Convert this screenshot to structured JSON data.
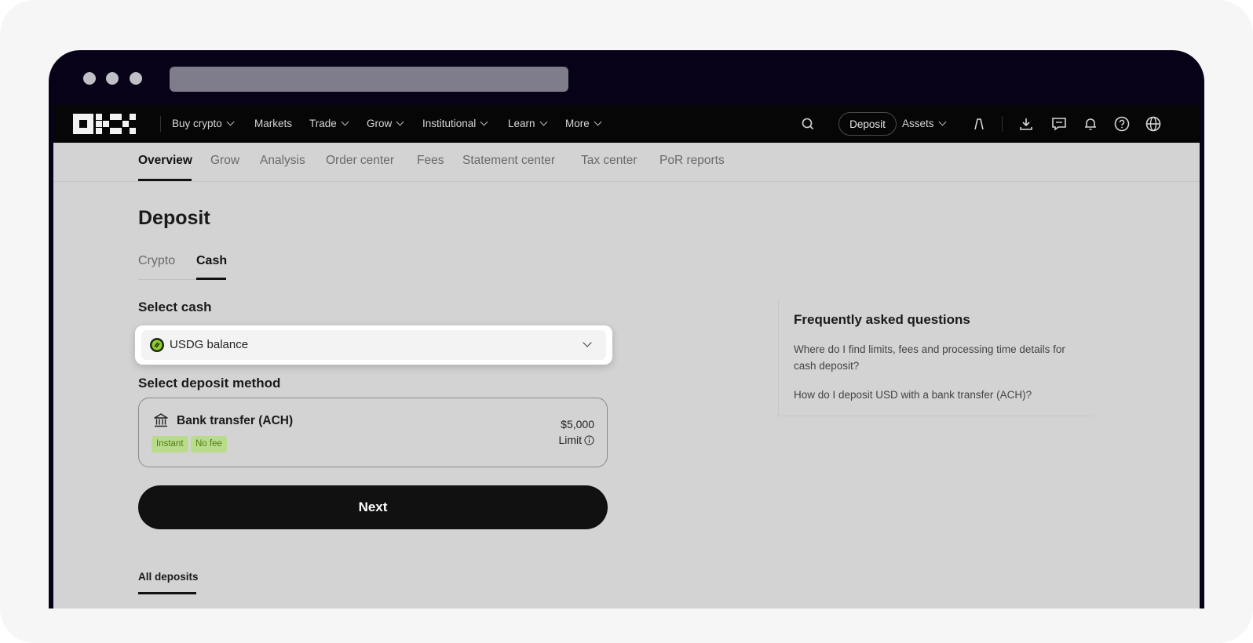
{
  "nav": {
    "items": [
      {
        "label": "Buy crypto",
        "dropdown": true
      },
      {
        "label": "Markets",
        "dropdown": false
      },
      {
        "label": "Trade",
        "dropdown": true
      },
      {
        "label": "Grow",
        "dropdown": true
      },
      {
        "label": "Institutional",
        "dropdown": true
      },
      {
        "label": "Learn",
        "dropdown": true
      },
      {
        "label": "More",
        "dropdown": true
      }
    ],
    "deposit_label": "Deposit",
    "assets_label": "Assets"
  },
  "subtabs": [
    "Overview",
    "Grow",
    "Analysis",
    "Order center",
    "Fees",
    "Statement center",
    "Tax center",
    "PoR reports"
  ],
  "page": {
    "title": "Deposit",
    "tabs": [
      "Crypto",
      "Cash"
    ],
    "select_cash_label": "Select cash",
    "selected_cash": "USDG balance",
    "select_method_label": "Select deposit method",
    "method": {
      "title": "Bank transfer (ACH)",
      "tags": [
        "Instant",
        "No fee"
      ],
      "limit_value": "$5,000",
      "limit_label": "Limit"
    },
    "next_label": "Next",
    "all_deposits_label": "All deposits"
  },
  "faq": {
    "title": "Frequently asked questions",
    "questions": [
      "Where do I find limits, fees and processing time details for cash deposit?",
      "How do I deposit USD with a bank transfer (ACH)?"
    ]
  },
  "colors": {
    "browser_frame": "#070218",
    "nav_bg": "#060606",
    "page_bg": "#d3d3d3",
    "tag_bg": "#b9dc8c",
    "tag_text": "#4c7d12",
    "usdg_icon": "#8fce2a"
  }
}
